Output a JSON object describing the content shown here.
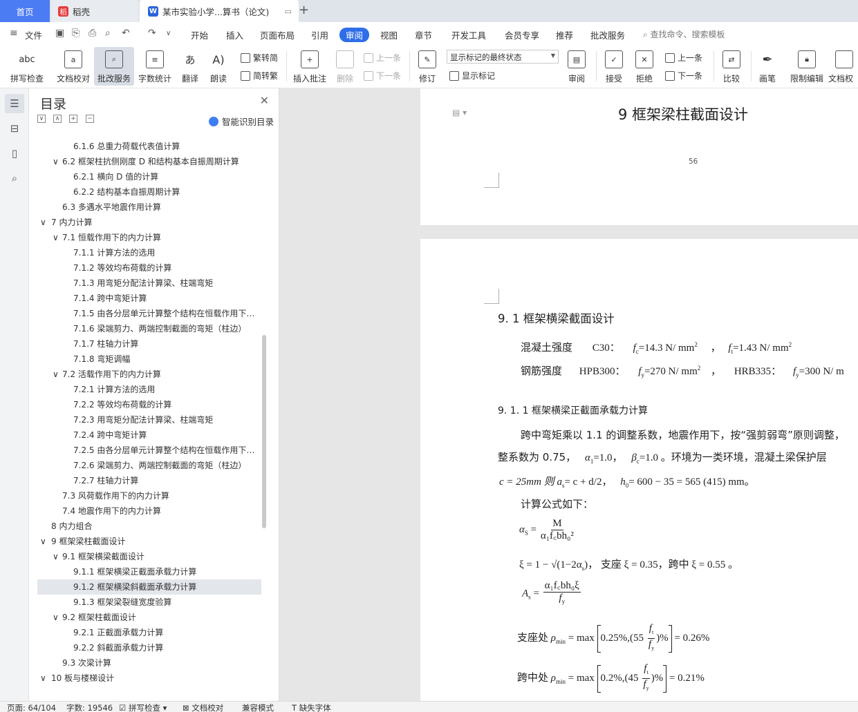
{
  "tabs": {
    "home": "首页",
    "daoke": "稻壳",
    "doc": "某市实验小学...算书（论文)",
    "add_icon": "plus-icon"
  },
  "menu": {
    "file": "文件",
    "items": [
      "开始",
      "插入",
      "页面布局",
      "引用",
      "审阅",
      "视图",
      "章节",
      "开发工具",
      "会员专享",
      "推荐",
      "批改服务"
    ],
    "search": "查找命令、搜索模板"
  },
  "ribbon": {
    "spell": "拼写检查",
    "doccheck": "文档校对",
    "correct": "批改服务",
    "wordcount": "字数统计",
    "translate": "翻译",
    "read": "朗读",
    "trad": "繁转简",
    "simp": "简转繁",
    "insert_comment": "插入批注",
    "delete": "删除",
    "prev": "上一条",
    "next": "下一条",
    "revise": "修订",
    "markup_state": "显示标记的最终状态",
    "show_markup": "显示标记",
    "review": "审阅",
    "accept": "接受",
    "reject": "拒绝",
    "prev2": "上一条",
    "next2": "下一条",
    "compare": "比较",
    "pen": "画笔",
    "restrict": "限制编辑",
    "docperm": "文档权"
  },
  "toc": {
    "title": "目录",
    "smart": "智能识别目录",
    "items": [
      {
        "text": "6.1.6 总重力荷载代表值计算",
        "level": 3,
        "toggle": ""
      },
      {
        "text": "6.2 框架柱抗侧刚度 D 和结构基本自振周期计算",
        "level": 2,
        "toggle": "∨"
      },
      {
        "text": "6.2.1 横向 D 值的计算",
        "level": 3,
        "toggle": ""
      },
      {
        "text": "6.2.2 结构基本自振周期计算",
        "level": 3,
        "toggle": ""
      },
      {
        "text": "6.3 多遇水平地震作用计算",
        "level": 2,
        "toggle": ""
      },
      {
        "text": "7  内力计算",
        "level": 1,
        "toggle": "∨"
      },
      {
        "text": "7.1 恒载作用下的内力计算",
        "level": 2,
        "toggle": "∨"
      },
      {
        "text": "7.1.1 计算方法的选用",
        "level": 3,
        "toggle": ""
      },
      {
        "text": "7.1.2 等效均布荷载的计算",
        "level": 3,
        "toggle": ""
      },
      {
        "text": "7.1.3 用弯矩分配法计算梁、柱端弯矩",
        "level": 3,
        "toggle": ""
      },
      {
        "text": "7.1.4 跨中弯矩计算",
        "level": 3,
        "toggle": ""
      },
      {
        "text": "7.1.5 由各分层单元计算整个结构在恒载作用下…",
        "level": 3,
        "toggle": ""
      },
      {
        "text": "7.1.6 梁端剪力、两端控制截面的弯矩（柱边）",
        "level": 3,
        "toggle": ""
      },
      {
        "text": "7.1.7 柱轴力计算",
        "level": 3,
        "toggle": ""
      },
      {
        "text": "7.1.8 弯矩调幅",
        "level": 3,
        "toggle": ""
      },
      {
        "text": "7.2  活载作用下的内力计算",
        "level": 2,
        "toggle": "∨"
      },
      {
        "text": "7.2.1 计算方法的选用",
        "level": 3,
        "toggle": ""
      },
      {
        "text": "7.2.2 等效均布荷载的计算",
        "level": 3,
        "toggle": ""
      },
      {
        "text": "7.2.3 用弯矩分配法计算梁、柱端弯矩",
        "level": 3,
        "toggle": ""
      },
      {
        "text": "7.2.4 跨中弯矩计算",
        "level": 3,
        "toggle": ""
      },
      {
        "text": "7.2.5 由各分层单元计算整个结构在恒载作用下…",
        "level": 3,
        "toggle": ""
      },
      {
        "text": "7.2.6 梁端剪力、两端控制截面的弯矩（柱边）",
        "level": 3,
        "toggle": ""
      },
      {
        "text": "7.2.7 柱轴力计算",
        "level": 3,
        "toggle": ""
      },
      {
        "text": "7.3  风荷载作用下的内力计算",
        "level": 2,
        "toggle": ""
      },
      {
        "text": "7.4  地震作用下的内力计算",
        "level": 2,
        "toggle": ""
      },
      {
        "text": "8  内力组合",
        "level": 1,
        "toggle": ""
      },
      {
        "text": "9  框架梁柱截面设计",
        "level": 1,
        "toggle": "∨",
        "selected": true
      },
      {
        "text": "9.1  框架横梁截面设计",
        "level": 2,
        "toggle": "∨"
      },
      {
        "text": "9.1.1  框架横梁正截面承载力计算",
        "level": 3,
        "toggle": ""
      },
      {
        "text": "9.1.2  框架横梁斜截面承载力计算",
        "level": 3,
        "toggle": ""
      },
      {
        "text": "9.1.3  框架梁裂缝宽度验算",
        "level": 3,
        "toggle": ""
      },
      {
        "text": "9.2 框架柱截面设计",
        "level": 2,
        "toggle": "∨"
      },
      {
        "text": "9.2.1  正截面承载力计算",
        "level": 3,
        "toggle": ""
      },
      {
        "text": "9.2.2  斜截面承载力计算",
        "level": 3,
        "toggle": ""
      },
      {
        "text": "9.3 次梁计算",
        "level": 2,
        "toggle": ""
      },
      {
        "text": "10  板与楼梯设计",
        "level": 1,
        "toggle": "∨"
      }
    ]
  },
  "doc": {
    "chapter_heading": "9  框架梁柱截面设计",
    "page_number": "56",
    "sec_9_1": "9. 1  框架横梁截面设计",
    "concrete_label": "混凝土强度",
    "concrete_grade": "C30：",
    "fc_val": "=14.3 N/ mm",
    "ft_val": "=1.43 N/ mm",
    "rebar_label": "钢筋强度",
    "hpb": "HPB300：",
    "fy1_val": "=270 N/ mm",
    "hrb": "HRB335：",
    "fy2_val": "=300 N/ m",
    "sec_9_1_1": "9. 1. 1  框架横梁正截面承载力计算",
    "para1": "跨中弯矩乘以 1.1 的调整系数，地震作用下，按“强剪弱弯”原则调整，",
    "para2a": "整系数为 0.75，",
    "para2b": "=1.0，",
    "para2c": "=1.0 。环境为一类环境，混凝土梁保护层",
    "para3a": "c = 25mm 则",
    "para3b": "= c + d/2，",
    "para3c": "= 600 − 35 = 565    (415) mm。",
    "formula_intro": "计算公式如下：",
    "f1_num": "M",
    "f1_den": "α₁f꜀bh₀²",
    "xi_left": "ξ = 1 − √(1−2α",
    "xi_right": ")，  支座 ξ = 0.35，跨中 ξ = 0.55 。",
    "as_num": "α₁f꜀bh₀ξ",
    "as_den": "f",
    "support_label": "支座处",
    "support_eq": "= max",
    "support_in": "0.25%,",
    "support_res": "= 0.26%",
    "mid_label": "跨中处",
    "mid_eq": "= max",
    "mid_in": "0.2%,",
    "mid_res": "= 0.21%"
  },
  "status": {
    "page": "页面: 64/104",
    "words": "字数: 19546",
    "spell": "拼写检查",
    "doccheck": "文档校对",
    "compat": "兼容模式",
    "missing_font": "缺失字体"
  }
}
